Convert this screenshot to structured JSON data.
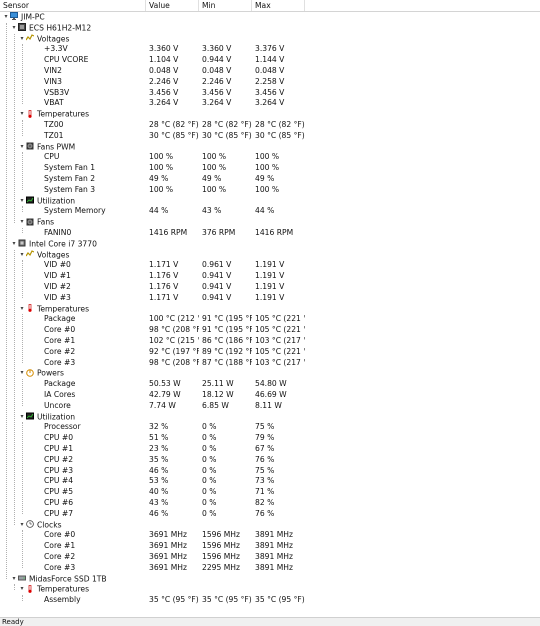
{
  "header": {
    "sensor": "Sensor",
    "value": "Value",
    "min": "Min",
    "max": "Max"
  },
  "status": "Ready",
  "rows": [
    {
      "lvl": 0,
      "icon": "monitor-icon",
      "text": "JIM-PC"
    },
    {
      "lvl": 1,
      "icon": "motherboard-icon",
      "text": "ECS H61H2-M12"
    },
    {
      "lvl": 2,
      "icon": "voltage-icon",
      "text": "Voltages"
    },
    {
      "lvl": 3,
      "text": "+3.3V",
      "v": "3.360 V",
      "mn": "3.360 V",
      "mx": "3.376 V"
    },
    {
      "lvl": 3,
      "text": "CPU VCORE",
      "v": "1.104 V",
      "mn": "0.944 V",
      "mx": "1.144 V"
    },
    {
      "lvl": 3,
      "text": "VIN2",
      "v": "0.048 V",
      "mn": "0.048 V",
      "mx": "0.048 V"
    },
    {
      "lvl": 3,
      "text": "VIN3",
      "v": "2.246 V",
      "mn": "2.246 V",
      "mx": "2.258 V"
    },
    {
      "lvl": 3,
      "text": "VSB3V",
      "v": "3.456 V",
      "mn": "3.456 V",
      "mx": "3.456 V"
    },
    {
      "lvl": 3,
      "text": "VBAT",
      "v": "3.264 V",
      "mn": "3.264 V",
      "mx": "3.264 V"
    },
    {
      "lvl": 2,
      "icon": "thermometer-icon",
      "text": "Temperatures"
    },
    {
      "lvl": 3,
      "text": "TZ00",
      "v": "28 °C  (82 °F)",
      "mn": "28 °C  (82 °F)",
      "mx": "28 °C  (82 °F)"
    },
    {
      "lvl": 3,
      "text": "TZ01",
      "v": "30 °C  (85 °F)",
      "mn": "30 °C  (85 °F)",
      "mx": "30 °C  (85 °F)"
    },
    {
      "lvl": 2,
      "icon": "fan-icon",
      "text": "Fans PWM"
    },
    {
      "lvl": 3,
      "text": "CPU",
      "v": "100 %",
      "mn": "100 %",
      "mx": "100 %"
    },
    {
      "lvl": 3,
      "text": "System Fan 1",
      "v": "100 %",
      "mn": "100 %",
      "mx": "100 %"
    },
    {
      "lvl": 3,
      "text": "System Fan 2",
      "v": "49 %",
      "mn": "49 %",
      "mx": "49 %"
    },
    {
      "lvl": 3,
      "text": "System Fan 3",
      "v": "100 %",
      "mn": "100 %",
      "mx": "100 %"
    },
    {
      "lvl": 2,
      "icon": "utilization-icon",
      "text": "Utilization"
    },
    {
      "lvl": 3,
      "text": "System Memory",
      "v": "44 %",
      "mn": "43 %",
      "mx": "44 %"
    },
    {
      "lvl": 2,
      "icon": "fan-icon",
      "text": "Fans"
    },
    {
      "lvl": 3,
      "text": "FANIN0",
      "v": "1416 RPM",
      "mn": "376 RPM",
      "mx": "1416 RPM"
    },
    {
      "lvl": 1,
      "icon": "cpu-icon",
      "text": "Intel Core i7 3770"
    },
    {
      "lvl": 2,
      "icon": "voltage-icon",
      "text": "Voltages"
    },
    {
      "lvl": 3,
      "text": "VID #0",
      "v": "1.171 V",
      "mn": "0.961 V",
      "mx": "1.191 V"
    },
    {
      "lvl": 3,
      "text": "VID #1",
      "v": "1.176 V",
      "mn": "0.941 V",
      "mx": "1.191 V"
    },
    {
      "lvl": 3,
      "text": "VID #2",
      "v": "1.176 V",
      "mn": "0.941 V",
      "mx": "1.191 V"
    },
    {
      "lvl": 3,
      "text": "VID #3",
      "v": "1.171 V",
      "mn": "0.941 V",
      "mx": "1.191 V"
    },
    {
      "lvl": 2,
      "icon": "thermometer-icon",
      "text": "Temperatures"
    },
    {
      "lvl": 3,
      "text": "Package",
      "v": "100 °C  (212 °...",
      "mn": "91 °C  (195 °F)",
      "mx": "105 °C  (221 °..."
    },
    {
      "lvl": 3,
      "text": "Core #0",
      "v": "98 °C  (208 °F)",
      "mn": "91 °C  (195 °F)",
      "mx": "105 °C  (221 °..."
    },
    {
      "lvl": 3,
      "text": "Core #1",
      "v": "102 °C  (215 °...",
      "mn": "86 °C  (186 °F)",
      "mx": "103 °C  (217 °..."
    },
    {
      "lvl": 3,
      "text": "Core #2",
      "v": "92 °C  (197 °F)",
      "mn": "89 °C  (192 °F)",
      "mx": "105 °C  (221 °..."
    },
    {
      "lvl": 3,
      "text": "Core #3",
      "v": "98 °C  (208 °F)",
      "mn": "87 °C  (188 °F)",
      "mx": "103 °C  (217 °..."
    },
    {
      "lvl": 2,
      "icon": "power-icon",
      "text": "Powers"
    },
    {
      "lvl": 3,
      "text": "Package",
      "v": "50.53 W",
      "mn": "25.11 W",
      "mx": "54.80 W"
    },
    {
      "lvl": 3,
      "text": "IA Cores",
      "v": "42.79 W",
      "mn": "18.12 W",
      "mx": "46.69 W"
    },
    {
      "lvl": 3,
      "text": "Uncore",
      "v": "7.74 W",
      "mn": "6.85 W",
      "mx": "8.11 W"
    },
    {
      "lvl": 2,
      "icon": "utilization-icon",
      "text": "Utilization"
    },
    {
      "lvl": 3,
      "text": "Processor",
      "v": "32 %",
      "mn": "0 %",
      "mx": "75 %"
    },
    {
      "lvl": 3,
      "text": "CPU #0",
      "v": "51 %",
      "mn": "0 %",
      "mx": "79 %"
    },
    {
      "lvl": 3,
      "text": "CPU #1",
      "v": "23 %",
      "mn": "0 %",
      "mx": "67 %"
    },
    {
      "lvl": 3,
      "text": "CPU #2",
      "v": "35 %",
      "mn": "0 %",
      "mx": "76 %"
    },
    {
      "lvl": 3,
      "text": "CPU #3",
      "v": "46 %",
      "mn": "0 %",
      "mx": "75 %"
    },
    {
      "lvl": 3,
      "text": "CPU #4",
      "v": "53 %",
      "mn": "0 %",
      "mx": "73 %"
    },
    {
      "lvl": 3,
      "text": "CPU #5",
      "v": "40 %",
      "mn": "0 %",
      "mx": "71 %"
    },
    {
      "lvl": 3,
      "text": "CPU #6",
      "v": "43 %",
      "mn": "0 %",
      "mx": "82 %"
    },
    {
      "lvl": 3,
      "text": "CPU #7",
      "v": "46 %",
      "mn": "0 %",
      "mx": "76 %"
    },
    {
      "lvl": 2,
      "icon": "clock-icon",
      "text": "Clocks"
    },
    {
      "lvl": 3,
      "text": "Core #0",
      "v": "3691 MHz",
      "mn": "1596 MHz",
      "mx": "3891 MHz"
    },
    {
      "lvl": 3,
      "text": "Core #1",
      "v": "3691 MHz",
      "mn": "1596 MHz",
      "mx": "3891 MHz"
    },
    {
      "lvl": 3,
      "text": "Core #2",
      "v": "3691 MHz",
      "mn": "1596 MHz",
      "mx": "3891 MHz"
    },
    {
      "lvl": 3,
      "text": "Core #3",
      "v": "3691 MHz",
      "mn": "2295 MHz",
      "mx": "3891 MHz"
    },
    {
      "lvl": 1,
      "icon": "drive-icon",
      "text": "MidasForce SSD 1TB"
    },
    {
      "lvl": 2,
      "icon": "thermometer-icon",
      "text": "Temperatures"
    },
    {
      "lvl": 3,
      "text": "Assembly",
      "v": "35 °C  (95 °F)",
      "mn": "35 °C  (95 °F)",
      "mx": "35 °C  (95 °F)"
    }
  ]
}
